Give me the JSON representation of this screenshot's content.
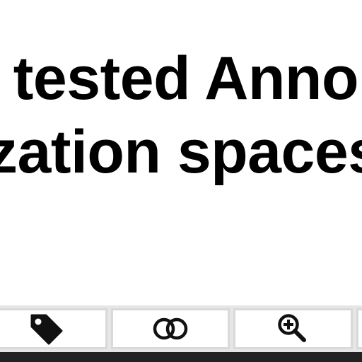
{
  "article": {
    "line1": "l tested Anno",
    "line2": "zation spaces"
  },
  "toolbar": {
    "buttons": [
      {
        "icon": "tag-icon"
      },
      {
        "icon": "overlap-circles-icon"
      },
      {
        "icon": "zoom-in-icon"
      },
      {
        "icon": "unknown-icon"
      }
    ]
  },
  "colors": {
    "text": "#000000",
    "toolbar_bg": "#e6e6e6",
    "button_bg": "#ffffff",
    "button_border": "#d9d9d9",
    "icon": "#111111",
    "bottom_bar": "#232323"
  }
}
